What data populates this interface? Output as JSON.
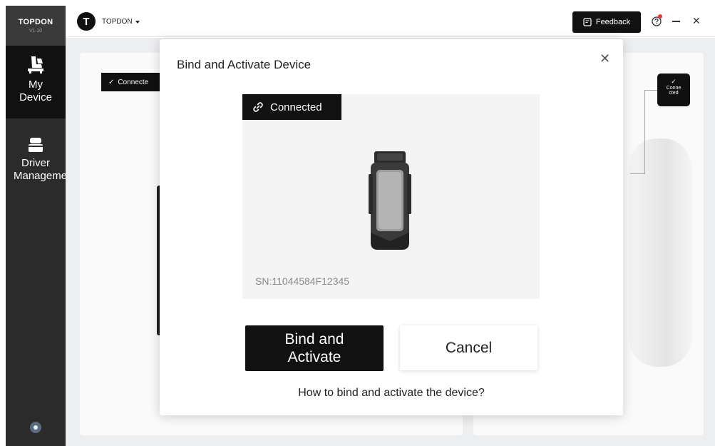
{
  "app": {
    "brand": "TOPDON",
    "version": "V1.10"
  },
  "sidebar": {
    "items": [
      {
        "label": "My Device",
        "icon": "car-seat-icon",
        "active": true
      },
      {
        "label": "Driver Management",
        "icon": "device-box-icon",
        "active": false
      }
    ],
    "settings_icon": "settings-icon"
  },
  "topbar": {
    "account_name": "TOPDON",
    "avatar_letter": "T",
    "feedback_label": "Feedback"
  },
  "background": {
    "left_badge": "Connecte",
    "right_badge_line1": "Conne",
    "right_badge_line2": "cted"
  },
  "modal": {
    "title": "Bind and Activate Device",
    "status_tag": "Connected",
    "serial": "SN:11044584F12345",
    "bind_label_line1": "Bind and",
    "bind_label_line2": "Activate",
    "cancel_label": "Cancel",
    "help_link": "How to bind and activate the device?"
  },
  "colors": {
    "primary": "#111111",
    "sidebar": "#2b2b2b",
    "panel": "#f4f4f4",
    "content_bg": "#f2f3f5"
  }
}
